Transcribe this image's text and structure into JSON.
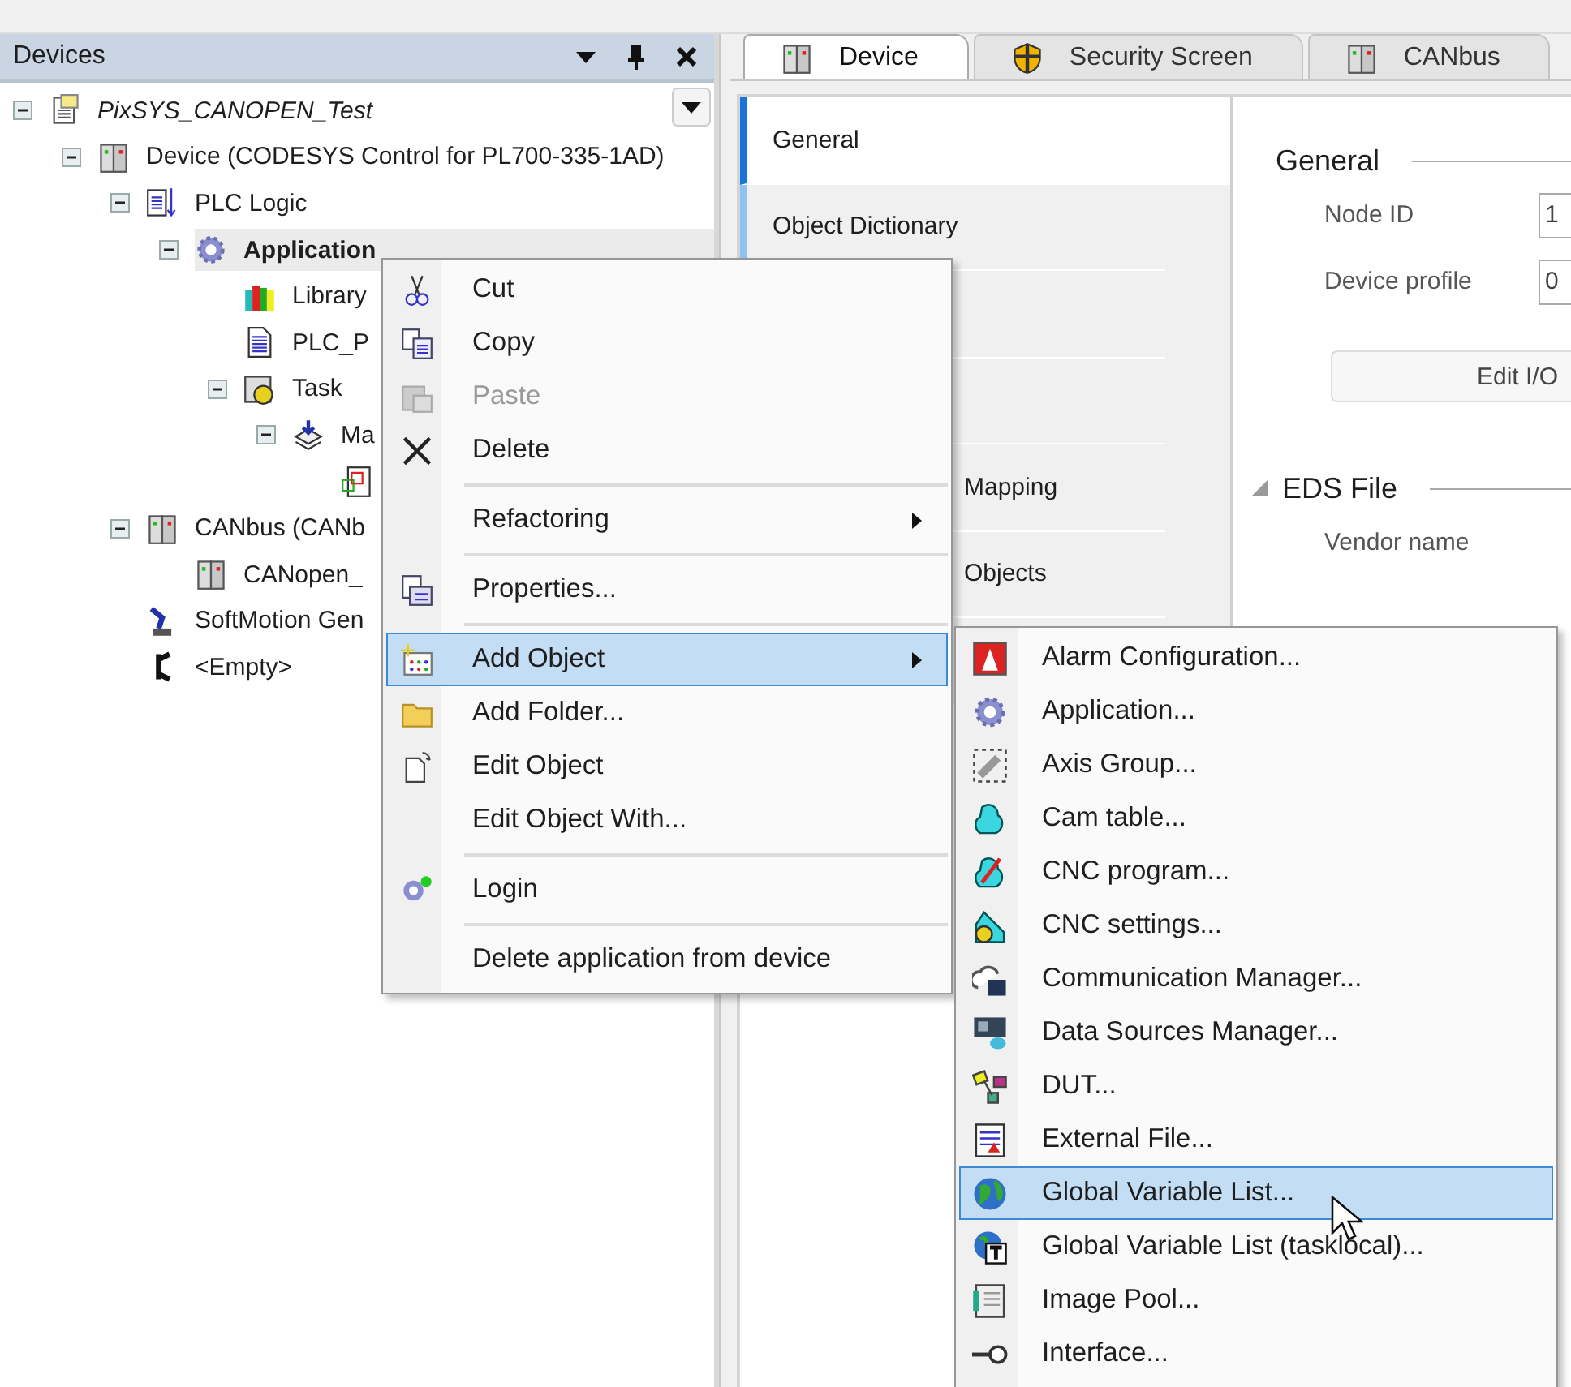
{
  "devices_panel": {
    "title": "Devices"
  },
  "tree": [
    {
      "label": "PixSYS_CANOPEN_Test",
      "kind": "project",
      "selected": false,
      "expanded": true,
      "children": [
        {
          "label": "Device (CODESYS Control for PL700-335-1AD)",
          "kind": "node",
          "selected": false,
          "expanded": true,
          "children": [
            {
              "label": "PLC Logic",
              "kind": "node",
              "selected": false,
              "expanded": true,
              "children": [
                {
                  "label": "Application",
                  "kind": "active",
                  "selected": true,
                  "expanded": true,
                  "children": [
                    {
                      "label": "Library",
                      "kind": "node",
                      "selected": false
                    },
                    {
                      "label": "PLC_P",
                      "kind": "node",
                      "selected": false
                    },
                    {
                      "label": "Task",
                      "kind": "node",
                      "selected": false,
                      "expanded": true,
                      "children": [
                        {
                          "label": "Ma",
                          "kind": "node",
                          "selected": false,
                          "expanded": true,
                          "children": [
                            {
                              "selected": false
                            }
                          ]
                        }
                      ]
                    }
                  ]
                }
              ]
            },
            {
              "label": "CANbus (CANb",
              "kind": "node",
              "selected": false,
              "expanded": true,
              "children": [
                {
                  "label": "CANopen_",
                  "kind": "node",
                  "selected": false
                }
              ]
            },
            {
              "label": "SoftMotion Gen",
              "kind": "node",
              "selected": false
            },
            {
              "label": "<Empty>",
              "kind": "node",
              "selected": false
            }
          ]
        }
      ]
    }
  ],
  "editor_tabs": [
    {
      "label": "Device",
      "selected": true
    },
    {
      "label": "Security Screen",
      "selected": false
    },
    {
      "label": "CANbus",
      "selected": false
    }
  ],
  "editor_nav": [
    {
      "label": "General",
      "kind": "full",
      "selected": true
    },
    {
      "label": "Object Dictionary",
      "kind": "full",
      "selected": false
    },
    {
      "kind": "covered",
      "selected": false
    },
    {
      "kind": "covered",
      "selected": false
    },
    {
      "label": "Mapping",
      "kind": "covered",
      "selected": false
    },
    {
      "label": "Objects",
      "kind": "covered",
      "selected": false
    },
    {
      "kind": "covered",
      "selected": false
    }
  ],
  "general_group": {
    "title": "General",
    "fields": [
      {
        "label": "Node ID",
        "value": "1"
      },
      {
        "label": "Device profile",
        "value": "0"
      }
    ],
    "button": "Edit I/O"
  },
  "eds_group": {
    "title": "EDS File",
    "fields": [
      {
        "label": "Vendor name"
      }
    ]
  },
  "context_menu": [
    {
      "kind": "item",
      "label": "Cut",
      "disabled": false,
      "selected": false,
      "submenu": false
    },
    {
      "kind": "item",
      "label": "Copy",
      "disabled": false,
      "selected": false,
      "submenu": false
    },
    {
      "kind": "item",
      "label": "Paste",
      "disabled": true,
      "selected": false,
      "submenu": false
    },
    {
      "kind": "item",
      "label": "Delete",
      "disabled": false,
      "selected": false,
      "submenu": false
    },
    {
      "kind": "separator"
    },
    {
      "kind": "item",
      "label": "Refactoring",
      "disabled": false,
      "selected": false,
      "submenu": true
    },
    {
      "kind": "separator"
    },
    {
      "kind": "item",
      "label": "Properties...",
      "disabled": false,
      "selected": false,
      "submenu": false
    },
    {
      "kind": "separator"
    },
    {
      "kind": "item",
      "label": "Add Object",
      "disabled": false,
      "selected": true,
      "submenu": true
    },
    {
      "kind": "item",
      "label": "Add Folder...",
      "disabled": false,
      "selected": false,
      "submenu": false
    },
    {
      "kind": "item",
      "label": "Edit Object",
      "disabled": false,
      "selected": false,
      "submenu": false
    },
    {
      "kind": "item",
      "label": "Edit Object With...",
      "disabled": false,
      "selected": false,
      "submenu": false
    },
    {
      "kind": "separator"
    },
    {
      "kind": "item",
      "label": "Login",
      "disabled": false,
      "selected": false,
      "submenu": false
    },
    {
      "kind": "separator"
    },
    {
      "kind": "item",
      "label": "Delete application from device",
      "disabled": false,
      "selected": false,
      "submenu": false
    }
  ],
  "add_object_menu": [
    {
      "label": "Alarm Configuration...",
      "selected": false
    },
    {
      "label": "Application...",
      "selected": false
    },
    {
      "label": "Axis Group...",
      "selected": false
    },
    {
      "label": "Cam table...",
      "selected": false
    },
    {
      "label": "CNC program...",
      "selected": false
    },
    {
      "label": "CNC settings...",
      "selected": false
    },
    {
      "label": "Communication Manager...",
      "selected": false
    },
    {
      "label": "Data Sources Manager...",
      "selected": false
    },
    {
      "label": "DUT...",
      "selected": false
    },
    {
      "label": "External File...",
      "selected": false
    },
    {
      "label": "Global Variable List...",
      "selected": true
    },
    {
      "label": "Global Variable List (tasklocal)...",
      "selected": false
    },
    {
      "label": "Image Pool...",
      "selected": false
    },
    {
      "label": "Interface...",
      "selected": false
    }
  ]
}
